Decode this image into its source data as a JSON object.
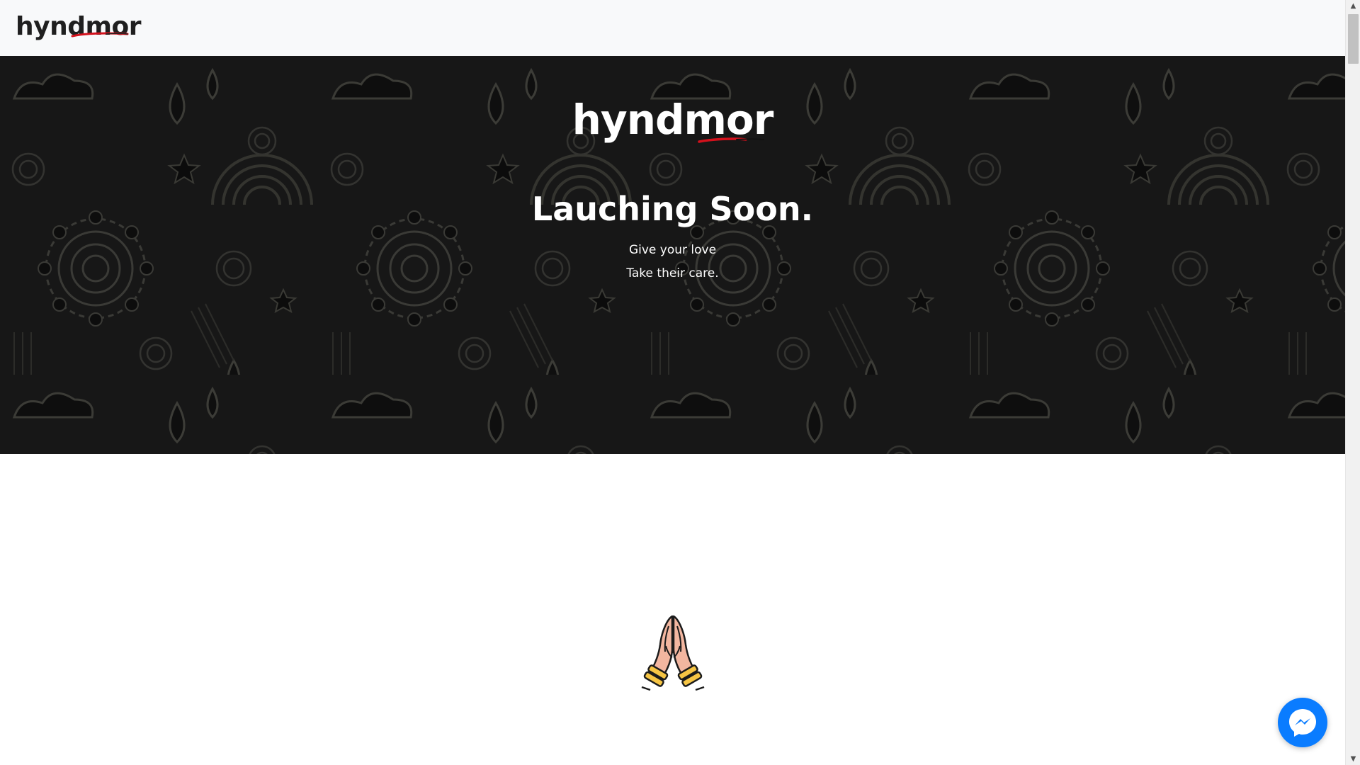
{
  "navbar": {
    "brand": "hyndmor"
  },
  "hero": {
    "logo": "hyndmor",
    "heading": "Lauching Soon.",
    "line1": "Give your love",
    "line2": "Take their care."
  },
  "icons": {
    "namaste": "folded-hands-icon",
    "chat": "messenger-icon"
  },
  "colors": {
    "brand_underline": "#d4111c",
    "hero_background": "#171717",
    "messenger": "#0a7cff"
  }
}
